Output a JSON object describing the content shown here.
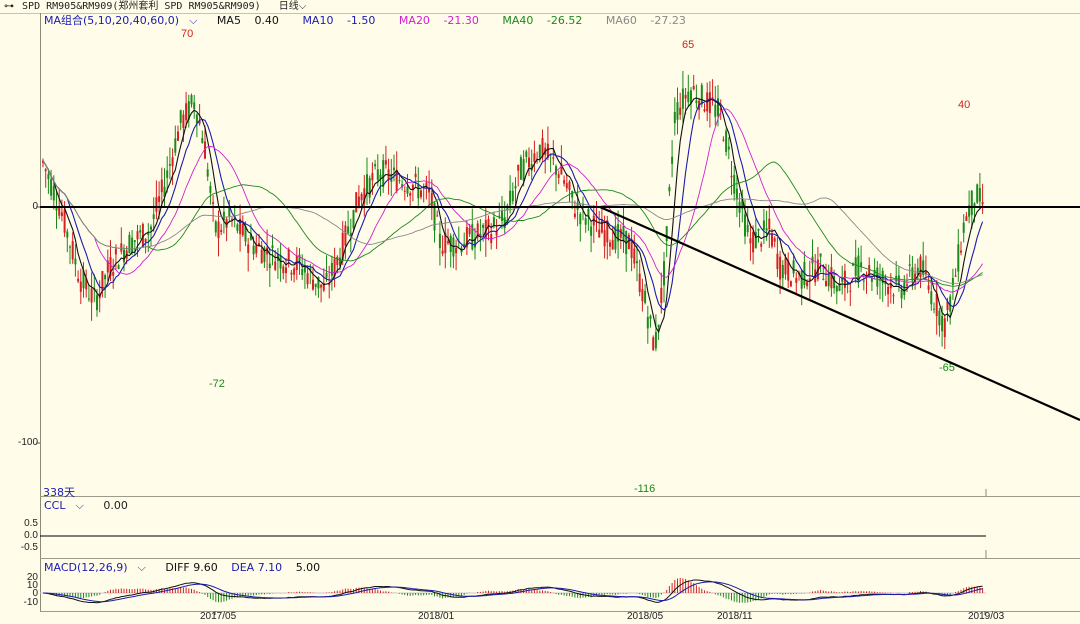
{
  "window": {
    "title": "SPD RM905&RM909(郑州套利 SPD RM905&RM909)",
    "period": "日线",
    "icon": "pair-link-icon"
  },
  "main_panel": {
    "indicator": "MA组合(5,10,20,40,60,0)",
    "ma": [
      {
        "label": "MA5",
        "value": "0.40",
        "color": "#111111"
      },
      {
        "label": "MA10",
        "value": "-1.50",
        "color": "#1b1bb0"
      },
      {
        "label": "MA20",
        "value": "-21.30",
        "color": "#d020d0"
      },
      {
        "label": "MA40",
        "value": "-26.52",
        "color": "#1a8a1a"
      },
      {
        "label": "MA60",
        "value": "-27.23",
        "color": "#888888"
      }
    ],
    "y_ticks": [
      "0",
      "-100"
    ],
    "days_label": "338天",
    "annotations": [
      {
        "text": "70",
        "color": "#d42020"
      },
      {
        "text": "-72",
        "color": "#1a8a1a"
      },
      {
        "text": "65",
        "color": "#d42020"
      },
      {
        "text": "-116",
        "color": "#1a8a1a"
      },
      {
        "text": "40",
        "color": "#d42020"
      },
      {
        "text": "-65",
        "color": "#1a8a1a"
      }
    ]
  },
  "ccl_panel": {
    "indicator": "CCL",
    "value": "0.00",
    "y_ticks": [
      "0.5",
      "0.0",
      "-0.5"
    ]
  },
  "macd_panel": {
    "indicator": "MACD(12,26,9)",
    "diff": "DIFF 9.60",
    "dea": "DEA 7.10",
    "macd": "5.00",
    "y_ticks": [
      "20",
      "10",
      "0",
      "-10"
    ]
  },
  "x_axis": [
    "2017/05",
    "2018/01",
    "2018/05",
    "2018/11",
    "2019/03"
  ],
  "colors": {
    "up": "#d42020",
    "down": "#1a8a1a",
    "background": "#fffde9"
  }
}
